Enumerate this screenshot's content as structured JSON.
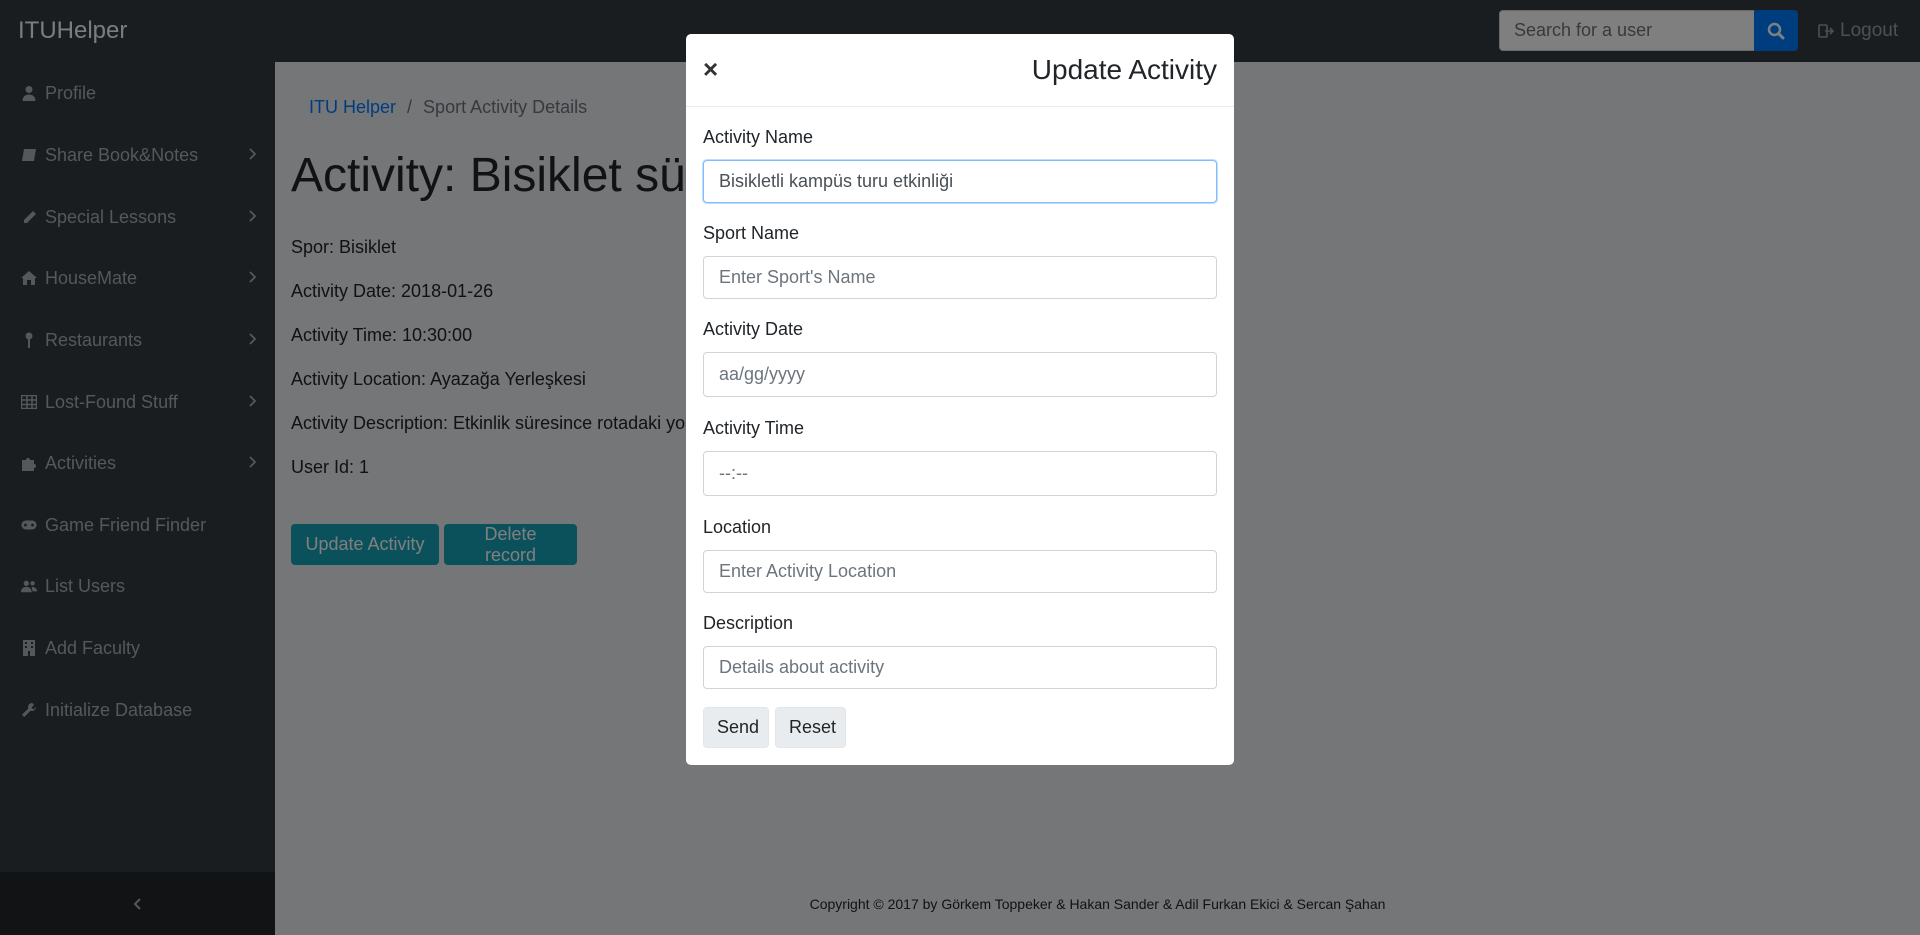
{
  "navbar": {
    "brand": "ITUHelper",
    "search_placeholder": "Search for a user",
    "logout_label": "Logout"
  },
  "sidebar": {
    "items": [
      {
        "label": "Profile",
        "icon": "user-icon",
        "has_submenu": false
      },
      {
        "label": "Share Book&Notes",
        "icon": "book-icon",
        "has_submenu": true
      },
      {
        "label": "Special Lessons",
        "icon": "pencil-icon",
        "has_submenu": true
      },
      {
        "label": "HouseMate",
        "icon": "home-icon",
        "has_submenu": true
      },
      {
        "label": "Restaurants",
        "icon": "map-marker-icon",
        "has_submenu": true
      },
      {
        "label": "Lost-Found Stuff",
        "icon": "table-icon",
        "has_submenu": true
      },
      {
        "label": "Activities",
        "icon": "puzzle-icon",
        "has_submenu": true
      },
      {
        "label": "Game Friend Finder",
        "icon": "gamepad-icon",
        "has_submenu": false
      },
      {
        "label": "List Users",
        "icon": "users-icon",
        "has_submenu": false
      },
      {
        "label": "Add Faculty",
        "icon": "building-icon",
        "has_submenu": false
      },
      {
        "label": "Initialize Database",
        "icon": "wrench-icon",
        "has_submenu": false
      }
    ]
  },
  "breadcrumb": {
    "home": "ITU Helper",
    "current": "Sport Activity Details"
  },
  "page": {
    "title": "Activity: Bisiklet sürm",
    "details": [
      "Spor: Bisiklet",
      "Activity Date: 2018-01-26",
      "Activity Time: 10:30:00",
      "Activity Location: Ayazağa Yerleşkesi",
      "Activity Description: Etkinlik süresince rotadaki yolla",
      "User Id: 1"
    ],
    "update_button": "Update Activity",
    "delete_button": "Delete record"
  },
  "footer": {
    "copyright": "Copyright © 2017 by Görkem Toppeker & Hakan Sander & Adil Furkan Ekici & Sercan Şahan"
  },
  "modal": {
    "close_glyph": "×",
    "title": "Update Activity",
    "fields": {
      "activity_name": {
        "label": "Activity Name",
        "value": "Bisikletli kampüs turu etkinliği",
        "placeholder": ""
      },
      "sport_name": {
        "label": "Sport Name",
        "value": "",
        "placeholder": "Enter Sport's Name"
      },
      "activity_date": {
        "label": "Activity Date",
        "value": "",
        "placeholder": "aa/gg/yyyy"
      },
      "activity_time": {
        "label": "Activity Time",
        "value": "",
        "placeholder": "--:--"
      },
      "location": {
        "label": "Location",
        "value": "",
        "placeholder": "Enter Activity Location"
      },
      "description": {
        "label": "Description",
        "value": "",
        "placeholder": "Details about activity"
      }
    },
    "send_label": "Send",
    "reset_label": "Reset"
  },
  "colors": {
    "navbar_bg": "#343a40",
    "accent_blue": "#007bff",
    "info_teal": "#17a2b8"
  }
}
